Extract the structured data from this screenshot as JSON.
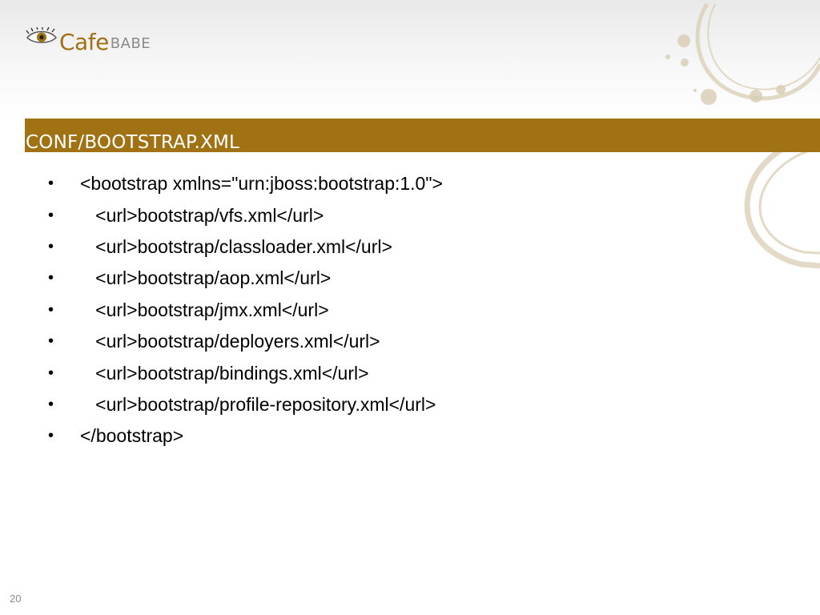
{
  "logo": {
    "name_primary": "Cafe",
    "name_secondary": "BABE",
    "icon": "eye-icon"
  },
  "title": "CONF/BOOTSTRAP.XML",
  "bullet_char": "•",
  "bullets": [
    "<bootstrap xmlns=\"urn:jboss:bootstrap:1.0\">",
    "   <url>bootstrap/vfs.xml</url>",
    "   <url>bootstrap/classloader.xml</url>",
    "   <url>bootstrap/aop.xml</url>",
    "   <url>bootstrap/jmx.xml</url>",
    "   <url>bootstrap/deployers.xml</url>",
    "   <url>bootstrap/bindings.xml</url>",
    "   <url>bootstrap/profile-repository.xml</url>",
    "</bootstrap>"
  ],
  "page_number": "20",
  "colors": {
    "accent": "#a07213",
    "logo_brand": "#a07014",
    "logo_secondary": "#8a8a8a",
    "stain": "#d9cdb4"
  }
}
